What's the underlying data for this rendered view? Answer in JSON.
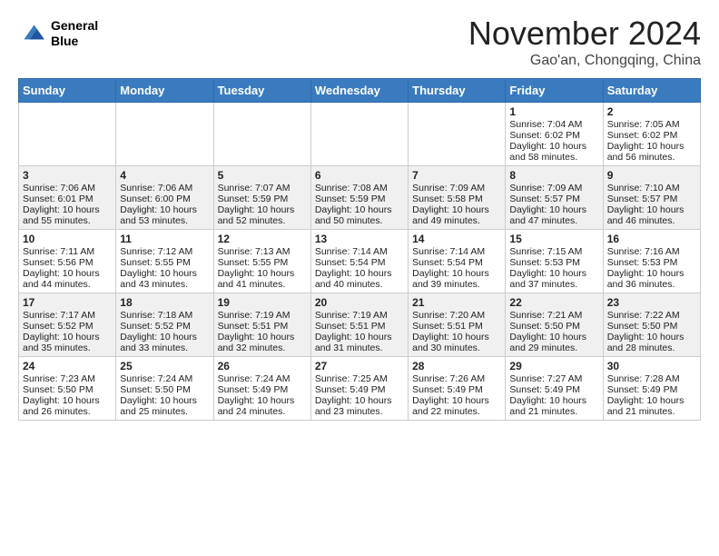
{
  "header": {
    "logo_line1": "General",
    "logo_line2": "Blue",
    "month_title": "November 2024",
    "location": "Gao'an, Chongqing, China"
  },
  "days_of_week": [
    "Sunday",
    "Monday",
    "Tuesday",
    "Wednesday",
    "Thursday",
    "Friday",
    "Saturday"
  ],
  "weeks": [
    [
      {
        "day": "",
        "content": ""
      },
      {
        "day": "",
        "content": ""
      },
      {
        "day": "",
        "content": ""
      },
      {
        "day": "",
        "content": ""
      },
      {
        "day": "",
        "content": ""
      },
      {
        "day": "1",
        "content": "Sunrise: 7:04 AM\nSunset: 6:02 PM\nDaylight: 10 hours and 58 minutes."
      },
      {
        "day": "2",
        "content": "Sunrise: 7:05 AM\nSunset: 6:02 PM\nDaylight: 10 hours and 56 minutes."
      }
    ],
    [
      {
        "day": "3",
        "content": "Sunrise: 7:06 AM\nSunset: 6:01 PM\nDaylight: 10 hours and 55 minutes."
      },
      {
        "day": "4",
        "content": "Sunrise: 7:06 AM\nSunset: 6:00 PM\nDaylight: 10 hours and 53 minutes."
      },
      {
        "day": "5",
        "content": "Sunrise: 7:07 AM\nSunset: 5:59 PM\nDaylight: 10 hours and 52 minutes."
      },
      {
        "day": "6",
        "content": "Sunrise: 7:08 AM\nSunset: 5:59 PM\nDaylight: 10 hours and 50 minutes."
      },
      {
        "day": "7",
        "content": "Sunrise: 7:09 AM\nSunset: 5:58 PM\nDaylight: 10 hours and 49 minutes."
      },
      {
        "day": "8",
        "content": "Sunrise: 7:09 AM\nSunset: 5:57 PM\nDaylight: 10 hours and 47 minutes."
      },
      {
        "day": "9",
        "content": "Sunrise: 7:10 AM\nSunset: 5:57 PM\nDaylight: 10 hours and 46 minutes."
      }
    ],
    [
      {
        "day": "10",
        "content": "Sunrise: 7:11 AM\nSunset: 5:56 PM\nDaylight: 10 hours and 44 minutes."
      },
      {
        "day": "11",
        "content": "Sunrise: 7:12 AM\nSunset: 5:55 PM\nDaylight: 10 hours and 43 minutes."
      },
      {
        "day": "12",
        "content": "Sunrise: 7:13 AM\nSunset: 5:55 PM\nDaylight: 10 hours and 41 minutes."
      },
      {
        "day": "13",
        "content": "Sunrise: 7:14 AM\nSunset: 5:54 PM\nDaylight: 10 hours and 40 minutes."
      },
      {
        "day": "14",
        "content": "Sunrise: 7:14 AM\nSunset: 5:54 PM\nDaylight: 10 hours and 39 minutes."
      },
      {
        "day": "15",
        "content": "Sunrise: 7:15 AM\nSunset: 5:53 PM\nDaylight: 10 hours and 37 minutes."
      },
      {
        "day": "16",
        "content": "Sunrise: 7:16 AM\nSunset: 5:53 PM\nDaylight: 10 hours and 36 minutes."
      }
    ],
    [
      {
        "day": "17",
        "content": "Sunrise: 7:17 AM\nSunset: 5:52 PM\nDaylight: 10 hours and 35 minutes."
      },
      {
        "day": "18",
        "content": "Sunrise: 7:18 AM\nSunset: 5:52 PM\nDaylight: 10 hours and 33 minutes."
      },
      {
        "day": "19",
        "content": "Sunrise: 7:19 AM\nSunset: 5:51 PM\nDaylight: 10 hours and 32 minutes."
      },
      {
        "day": "20",
        "content": "Sunrise: 7:19 AM\nSunset: 5:51 PM\nDaylight: 10 hours and 31 minutes."
      },
      {
        "day": "21",
        "content": "Sunrise: 7:20 AM\nSunset: 5:51 PM\nDaylight: 10 hours and 30 minutes."
      },
      {
        "day": "22",
        "content": "Sunrise: 7:21 AM\nSunset: 5:50 PM\nDaylight: 10 hours and 29 minutes."
      },
      {
        "day": "23",
        "content": "Sunrise: 7:22 AM\nSunset: 5:50 PM\nDaylight: 10 hours and 28 minutes."
      }
    ],
    [
      {
        "day": "24",
        "content": "Sunrise: 7:23 AM\nSunset: 5:50 PM\nDaylight: 10 hours and 26 minutes."
      },
      {
        "day": "25",
        "content": "Sunrise: 7:24 AM\nSunset: 5:50 PM\nDaylight: 10 hours and 25 minutes."
      },
      {
        "day": "26",
        "content": "Sunrise: 7:24 AM\nSunset: 5:49 PM\nDaylight: 10 hours and 24 minutes."
      },
      {
        "day": "27",
        "content": "Sunrise: 7:25 AM\nSunset: 5:49 PM\nDaylight: 10 hours and 23 minutes."
      },
      {
        "day": "28",
        "content": "Sunrise: 7:26 AM\nSunset: 5:49 PM\nDaylight: 10 hours and 22 minutes."
      },
      {
        "day": "29",
        "content": "Sunrise: 7:27 AM\nSunset: 5:49 PM\nDaylight: 10 hours and 21 minutes."
      },
      {
        "day": "30",
        "content": "Sunrise: 7:28 AM\nSunset: 5:49 PM\nDaylight: 10 hours and 21 minutes."
      }
    ]
  ]
}
